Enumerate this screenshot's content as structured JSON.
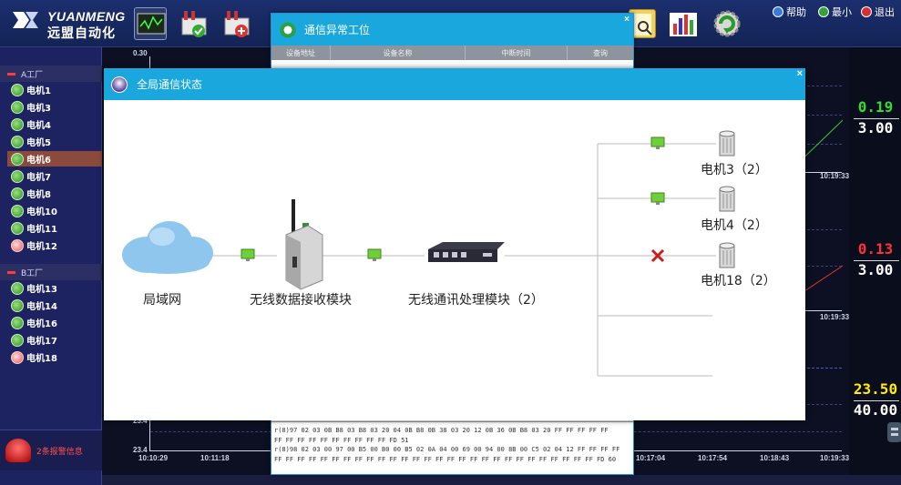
{
  "app": {
    "logo_en": "YUANMENG",
    "logo_cn": "远盟自动化",
    "links": {
      "help": "帮助",
      "minimize": "最小",
      "exit": "退出"
    }
  },
  "sidebar": {
    "group_a": "A工厂",
    "group_a_items": [
      {
        "label": "电机1",
        "status": "ok"
      },
      {
        "label": "电机3",
        "status": "ok"
      },
      {
        "label": "电机4",
        "status": "ok"
      },
      {
        "label": "电机5",
        "status": "ok"
      },
      {
        "label": "电机6",
        "status": "ok",
        "selected": true
      },
      {
        "label": "电机7",
        "status": "ok"
      },
      {
        "label": "电机8",
        "status": "ok"
      },
      {
        "label": "电机10",
        "status": "ok"
      },
      {
        "label": "电机11",
        "status": "ok"
      },
      {
        "label": "电机12",
        "status": "alarm"
      }
    ],
    "group_b": "B工厂",
    "group_b_items": [
      {
        "label": "电机13",
        "status": "ok"
      },
      {
        "label": "电机14",
        "status": "ok"
      },
      {
        "label": "电机16",
        "status": "ok"
      },
      {
        "label": "电机17",
        "status": "ok"
      },
      {
        "label": "电机18",
        "status": "alarm"
      }
    ],
    "alarm_text": "2条报警信息"
  },
  "charts": {
    "top_ymax": "0.30",
    "bottom_ymin": "23.4",
    "bottom_ytick": "23.4",
    "x_labels": [
      "10:10:29",
      "10:11:18",
      "10:17:04",
      "10:17:54",
      "10:18:43",
      "10:19:33"
    ],
    "right_time_1": "10:19:33",
    "right_time_2": "10:19:33"
  },
  "values": [
    {
      "current": "0.19",
      "limit": "3.00",
      "color": "#33dd33"
    },
    {
      "current": "0.13",
      "limit": "3.00",
      "color": "#ff3333"
    },
    {
      "current": "23.50",
      "limit": "40.00",
      "color": "#ffee00"
    }
  ],
  "comm_dialog": {
    "title": "通信异常工位",
    "close": "×",
    "columns": [
      "设备地址",
      "设备名称",
      "中断时间",
      "查询"
    ],
    "log": [
      "r(8)97 02 03 0B B8 03 B8 03 20 04 0B B8 0B 38 03 20 12 0B 36 0B B8 03 20 FF FF FF FF FF",
      "FF FF FF FF FF FF FF FF FF FF FD 51",
      "r(8)98 02 03 00 97 00 B5 00 B0 00 B5 02 0A 04 00 69 00 94 00 8B 00 C5 02 04 12 FF FF FF FF",
      "FF FF FF FF FF FF FF FF FF FF FF FF FF FF FF FF FF FF FF FF FF FF FF FF FF FF FF FF FD 60"
    ]
  },
  "global_dialog": {
    "title": "全局通信状态",
    "close": "×",
    "nodes": {
      "lan": "局域网",
      "receiver": "无线数据接收模块",
      "processor": "无线通讯处理模块（2）",
      "motors": [
        "电机3（2）",
        "电机4（2）",
        "电机18（2）"
      ]
    },
    "link_status": [
      "ok",
      "ok",
      "ok",
      "ok",
      "fail"
    ]
  }
}
